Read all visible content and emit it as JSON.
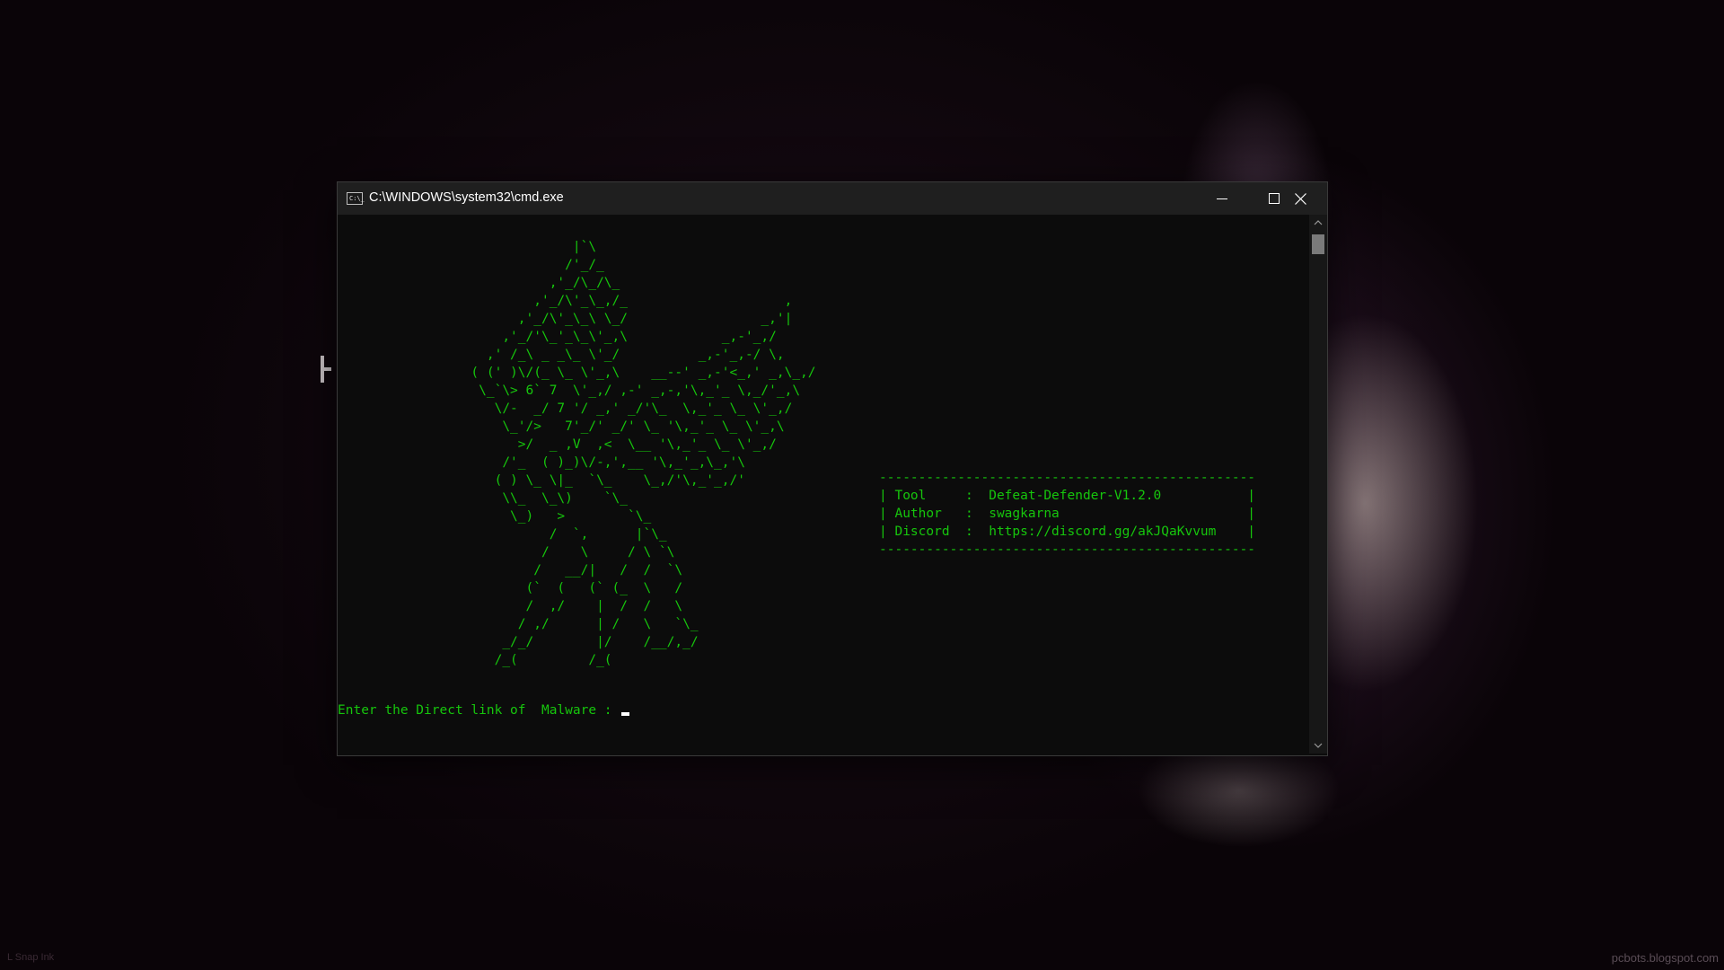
{
  "window": {
    "title": "C:\\WINDOWS\\system32\\cmd.exe",
    "icon": "cmd-icon",
    "icon_text": "C:\\_"
  },
  "console": {
    "ascii_art": "                              |`\\\n                             /'_/_\n                           ,'_/\\_/\\_\n                         ,'_/\\'_\\_,/_                    ,\n                       ,'_/\\'_\\_\\ \\_/                 _,'|\n                     ,'_/'\\_'_\\_\\'_,\\            _,-'_,/\n                   ,' /_\\ _ _\\_ \\'_/          _,-'_,-/ \\,\n                 ( (' )\\/(_ \\_ \\'_,\\    __--' _,-'<_,' _,\\_,/\n                  \\_`\\> 6` 7  \\'_,/ ,-' _,-,'\\,_'_ \\,_/'_,\\\n                    \\/-  _/ 7 '/ _,' _/'\\_  \\,_'_ \\_ \\'_,/\n                     \\_'/>   7'_/' _/' \\_ '\\,_'_ \\_ \\'_,\\\n                       >/  _ ,V  ,<  \\__ '\\,_'_ \\_ \\'_,/\n                     /'_  ( )_)\\/-,',__ '\\,_'_,\\_,'\\\n                    ( ) \\_ \\|_  `\\_    \\_,/'\\,_'_,/'\n                     \\\\_  \\_\\)    `\\_\n                      \\_)   >        `\\_\n                           /  `,      |`\\_\n                          /    \\     / \\ `\\\n                         /   __/|   /  /  `\\\n                        (`  (   (` (_  \\   /\n                        /  ,/    |  /  /   \\\n                       / ,/      | /   \\   `\\_\n                     _/_/        |/    /__/,_/\n                    /_(         /_(",
    "info_box": "------------------------------------------------\n| Tool     :  Defeat-Defender-V1.2.0           |\n| Author   :  swagkarna                        |\n| Discord  :  https://discord.gg/akJQaKvvum    |\n------------------------------------------------",
    "prompt": "Enter the Direct link of  Malware : "
  },
  "watermarks": {
    "left": "L Snap Ink",
    "right": "pcbots.blogspot.com"
  },
  "colors": {
    "console_text": "#16c60c",
    "console_bg": "#0c0c0c",
    "titlebar_bg": "#1f1f1f"
  }
}
